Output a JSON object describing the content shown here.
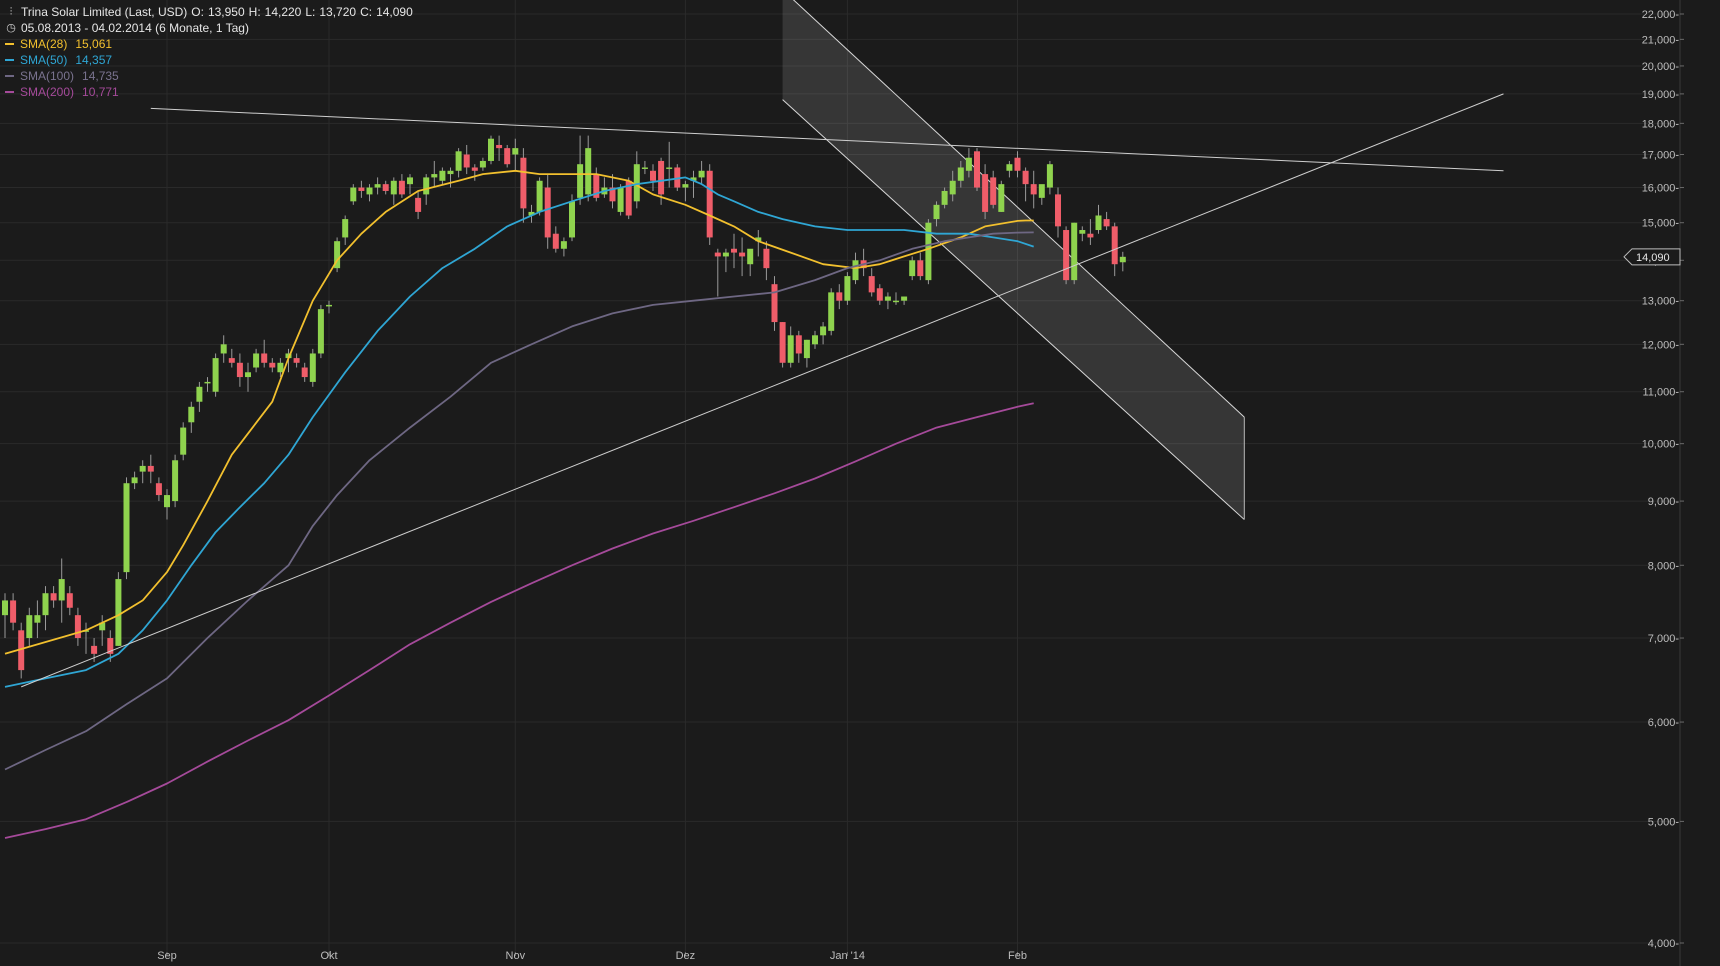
{
  "chart_data": {
    "type": "candlestick",
    "title": "Trina Solar Limited (Last, USD)",
    "quote": {
      "O": "13,950",
      "H": "14,220",
      "L": "13,720",
      "C": "14,090"
    },
    "period": "05.08.2013 - 04.02.2014 (6 Monate, 1 Tag)",
    "last_price_label": "14,090",
    "y_scale": "log",
    "ylim": [
      4000,
      22500
    ],
    "y_ticks": [
      {
        "value": 4000,
        "label": "4,000"
      },
      {
        "value": 5000,
        "label": "5,000"
      },
      {
        "value": 6000,
        "label": "6,000"
      },
      {
        "value": 7000,
        "label": "7,000"
      },
      {
        "value": 8000,
        "label": "8,000"
      },
      {
        "value": 9000,
        "label": "9,000"
      },
      {
        "value": 10000,
        "label": "10,000"
      },
      {
        "value": 11000,
        "label": "11,000"
      },
      {
        "value": 12000,
        "label": "12,000"
      },
      {
        "value": 13000,
        "label": "13,000"
      },
      {
        "value": 14000,
        "label": "14,000"
      },
      {
        "value": 15000,
        "label": "15,000"
      },
      {
        "value": 16000,
        "label": "16,000"
      },
      {
        "value": 17000,
        "label": "17,000"
      },
      {
        "value": 18000,
        "label": "18,000"
      },
      {
        "value": 19000,
        "label": "19,000"
      },
      {
        "value": 20000,
        "label": "20,000"
      },
      {
        "value": 21000,
        "label": "21,000"
      },
      {
        "value": 22000,
        "label": "22,000"
      }
    ],
    "x_ticks": [
      {
        "index": 20,
        "label": "Sep"
      },
      {
        "index": 40,
        "label": "Okt"
      },
      {
        "index": 63,
        "label": "Nov"
      },
      {
        "index": 84,
        "label": "Dez"
      },
      {
        "index": 104,
        "label": "Jan '14"
      },
      {
        "index": 125,
        "label": "Feb"
      }
    ],
    "grid": true,
    "colors": {
      "up": "#8fd34e",
      "down": "#ef5d69",
      "bg": "#1b1b1b",
      "grid": "#2a2a2a",
      "text": "#bdbdbd"
    },
    "candles": [
      [
        7.3,
        7.6,
        7.0,
        7.5
      ],
      [
        7.5,
        7.6,
        7.1,
        7.2
      ],
      [
        7.1,
        7.2,
        6.5,
        6.6
      ],
      [
        7.0,
        7.4,
        6.9,
        7.3
      ],
      [
        7.2,
        7.5,
        7.0,
        7.3
      ],
      [
        7.3,
        7.7,
        7.1,
        7.6
      ],
      [
        7.6,
        7.7,
        7.4,
        7.5
      ],
      [
        7.5,
        8.1,
        7.2,
        7.8
      ],
      [
        7.6,
        7.7,
        7.3,
        7.4
      ],
      [
        7.3,
        7.4,
        6.9,
        7.0
      ],
      [
        7.1,
        7.2,
        6.8,
        7.1
      ],
      [
        6.9,
        7.0,
        6.7,
        6.8
      ],
      [
        7.1,
        7.3,
        6.9,
        7.2
      ],
      [
        7.0,
        7.1,
        6.7,
        6.8
      ],
      [
        6.9,
        7.9,
        6.9,
        7.8
      ],
      [
        7.9,
        9.4,
        7.8,
        9.3
      ],
      [
        9.3,
        9.5,
        9.2,
        9.4
      ],
      [
        9.5,
        9.7,
        9.3,
        9.6
      ],
      [
        9.6,
        9.8,
        9.3,
        9.5
      ],
      [
        9.3,
        9.4,
        9.0,
        9.1
      ],
      [
        8.9,
        9.2,
        8.7,
        9.1
      ],
      [
        9.0,
        9.8,
        8.9,
        9.7
      ],
      [
        9.8,
        10.4,
        9.7,
        10.3
      ],
      [
        10.4,
        10.8,
        10.2,
        10.7
      ],
      [
        10.8,
        11.2,
        10.6,
        11.1
      ],
      [
        11.2,
        11.3,
        11.0,
        11.2
      ],
      [
        11.0,
        11.8,
        10.9,
        11.7
      ],
      [
        11.8,
        12.2,
        11.6,
        12.0
      ],
      [
        11.7,
        11.9,
        11.5,
        11.6
      ],
      [
        11.6,
        11.8,
        11.1,
        11.3
      ],
      [
        11.3,
        11.6,
        11.0,
        11.4
      ],
      [
        11.5,
        11.9,
        11.4,
        11.8
      ],
      [
        11.8,
        12.1,
        11.5,
        11.6
      ],
      [
        11.6,
        11.7,
        11.4,
        11.5
      ],
      [
        11.4,
        11.7,
        11.3,
        11.6
      ],
      [
        11.7,
        11.9,
        11.4,
        11.8
      ],
      [
        11.7,
        11.8,
        11.5,
        11.6
      ],
      [
        11.5,
        11.6,
        11.2,
        11.3
      ],
      [
        11.2,
        11.9,
        11.1,
        11.8
      ],
      [
        11.8,
        12.9,
        11.7,
        12.8
      ],
      [
        12.9,
        13.0,
        12.7,
        12.9
      ],
      [
        13.8,
        14.6,
        13.7,
        14.5
      ],
      [
        14.6,
        15.2,
        14.4,
        15.1
      ],
      [
        15.6,
        16.1,
        15.5,
        16.0
      ],
      [
        16.0,
        16.2,
        15.7,
        15.9
      ],
      [
        15.8,
        16.1,
        15.6,
        16.0
      ],
      [
        16.0,
        16.3,
        15.8,
        16.1
      ],
      [
        16.1,
        16.2,
        15.8,
        15.9
      ],
      [
        15.8,
        16.3,
        15.5,
        16.2
      ],
      [
        16.2,
        16.4,
        15.7,
        15.8
      ],
      [
        16.1,
        16.4,
        15.8,
        16.3
      ],
      [
        15.7,
        15.9,
        15.1,
        15.3
      ],
      [
        15.8,
        16.4,
        15.5,
        16.3
      ],
      [
        16.3,
        16.8,
        16.0,
        16.4
      ],
      [
        16.2,
        16.6,
        16.1,
        16.5
      ],
      [
        16.4,
        16.6,
        16.0,
        16.5
      ],
      [
        16.5,
        17.2,
        16.3,
        17.1
      ],
      [
        17.0,
        17.3,
        16.4,
        16.6
      ],
      [
        16.6,
        16.7,
        16.2,
        16.5
      ],
      [
        16.6,
        16.9,
        16.5,
        16.8
      ],
      [
        16.8,
        17.6,
        16.7,
        17.5
      ],
      [
        17.3,
        17.6,
        16.8,
        17.2
      ],
      [
        17.2,
        17.3,
        16.6,
        16.7
      ],
      [
        17.0,
        17.5,
        16.5,
        17.2
      ],
      [
        16.9,
        17.2,
        15.0,
        15.4
      ],
      [
        15.2,
        15.5,
        15.0,
        15.3
      ],
      [
        15.3,
        16.3,
        15.2,
        16.2
      ],
      [
        16.0,
        16.4,
        14.3,
        14.6
      ],
      [
        14.7,
        14.9,
        14.2,
        14.3
      ],
      [
        14.3,
        14.6,
        14.1,
        14.5
      ],
      [
        14.6,
        15.8,
        14.5,
        15.6
      ],
      [
        15.7,
        17.6,
        15.5,
        16.7
      ],
      [
        15.8,
        17.6,
        15.6,
        17.2
      ],
      [
        16.4,
        16.6,
        15.6,
        15.7
      ],
      [
        15.8,
        16.3,
        15.7,
        16.0
      ],
      [
        16.0,
        16.4,
        15.4,
        15.6
      ],
      [
        15.3,
        16.1,
        15.2,
        16.0
      ],
      [
        16.2,
        16.3,
        15.1,
        15.2
      ],
      [
        15.6,
        17.1,
        15.4,
        16.7
      ],
      [
        16.6,
        16.8,
        16.4,
        16.6
      ],
      [
        16.5,
        16.7,
        15.9,
        16.2
      ],
      [
        16.8,
        16.9,
        15.5,
        15.8
      ],
      [
        16.6,
        17.4,
        16.0,
        16.6
      ],
      [
        16.6,
        16.7,
        15.9,
        16.0
      ],
      [
        16.0,
        16.2,
        15.6,
        16.1
      ],
      [
        16.2,
        16.5,
        15.7,
        16.3
      ],
      [
        16.3,
        16.8,
        16.1,
        16.5
      ],
      [
        16.5,
        16.7,
        14.4,
        14.6
      ],
      [
        14.2,
        14.3,
        13.1,
        14.1
      ],
      [
        14.1,
        14.3,
        13.7,
        14.2
      ],
      [
        14.3,
        14.7,
        13.8,
        14.2
      ],
      [
        14.2,
        14.6,
        13.6,
        14.1
      ],
      [
        13.9,
        14.0,
        13.6,
        14.3
      ],
      [
        14.5,
        14.8,
        14.1,
        14.6
      ],
      [
        14.3,
        14.5,
        13.5,
        13.8
      ],
      [
        13.4,
        13.6,
        12.3,
        12.5
      ],
      [
        12.5,
        12.5,
        11.5,
        11.6
      ],
      [
        11.6,
        12.4,
        11.5,
        12.2
      ],
      [
        12.2,
        12.3,
        11.6,
        11.8
      ],
      [
        11.7,
        12.1,
        11.5,
        12.1
      ],
      [
        12.0,
        12.3,
        11.9,
        12.2
      ],
      [
        12.2,
        12.5,
        12.0,
        12.4
      ],
      [
        12.3,
        13.3,
        12.2,
        13.2
      ],
      [
        13.2,
        13.4,
        12.8,
        13.0
      ],
      [
        13.0,
        13.7,
        12.9,
        13.6
      ],
      [
        13.5,
        14.2,
        13.4,
        14.0
      ],
      [
        14.0,
        14.3,
        13.6,
        13.8
      ],
      [
        13.6,
        13.8,
        13.1,
        13.2
      ],
      [
        13.3,
        13.4,
        12.9,
        13.0
      ],
      [
        13.0,
        13.2,
        12.8,
        13.1
      ],
      [
        13.0,
        13.2,
        12.9,
        13.0
      ],
      [
        13.0,
        13.1,
        12.9,
        13.1
      ],
      [
        13.6,
        14.1,
        13.5,
        14.0
      ],
      [
        14.0,
        14.2,
        13.5,
        13.6
      ],
      [
        13.5,
        15.1,
        13.4,
        15.0
      ],
      [
        15.1,
        15.6,
        14.9,
        15.5
      ],
      [
        15.5,
        16.0,
        15.4,
        15.9
      ],
      [
        15.8,
        16.5,
        15.6,
        16.2
      ],
      [
        16.2,
        16.8,
        16.0,
        16.6
      ],
      [
        16.5,
        17.2,
        16.3,
        16.9
      ],
      [
        17.1,
        17.2,
        15.9,
        16.0
      ],
      [
        16.4,
        16.7,
        15.1,
        15.3
      ],
      [
        16.3,
        16.5,
        15.4,
        15.5
      ],
      [
        15.3,
        16.2,
        15.3,
        16.1
      ],
      [
        16.5,
        16.8,
        16.3,
        16.7
      ],
      [
        16.9,
        17.1,
        16.3,
        16.5
      ],
      [
        16.5,
        16.6,
        15.6,
        16.1
      ],
      [
        16.1,
        16.5,
        15.4,
        15.8
      ],
      [
        15.7,
        16.0,
        15.5,
        16.1
      ],
      [
        16.0,
        16.8,
        15.8,
        16.7
      ],
      [
        15.8,
        16.0,
        14.6,
        14.9
      ],
      [
        14.8,
        14.9,
        13.4,
        13.5
      ],
      [
        13.5,
        15.0,
        13.4,
        15.0
      ],
      [
        14.7,
        14.9,
        14.5,
        14.8
      ],
      [
        14.7,
        15.1,
        14.4,
        14.6
      ],
      [
        14.8,
        15.5,
        14.7,
        15.2
      ],
      [
        15.1,
        15.3,
        14.8,
        14.9
      ],
      [
        14.9,
        15.0,
        13.6,
        13.9
      ],
      [
        13.95,
        14.22,
        13.72,
        14.09
      ]
    ],
    "series": [
      {
        "name": "SMA(28)",
        "value_label": "15,061",
        "color": "#f2c02e",
        "x": [
          0,
          10,
          14,
          17,
          20,
          22,
          25,
          28,
          33,
          35,
          38,
          41,
          44,
          47,
          51,
          56,
          59,
          63,
          66,
          69,
          73,
          77,
          80,
          84,
          87,
          90,
          93,
          97,
          101,
          105,
          108,
          111,
          114,
          118,
          121,
          125,
          126,
          127
        ],
        "y": [
          6.8,
          7.1,
          7.3,
          7.5,
          7.9,
          8.3,
          9.0,
          9.8,
          10.8,
          11.7,
          13.0,
          14.0,
          14.7,
          15.3,
          15.9,
          16.2,
          16.4,
          16.5,
          16.4,
          16.4,
          16.4,
          16.2,
          15.8,
          15.5,
          15.2,
          14.9,
          14.5,
          14.2,
          13.9,
          13.8,
          13.9,
          14.1,
          14.3,
          14.6,
          14.9,
          15.05,
          15.06,
          15.061
        ]
      },
      {
        "name": "SMA(50)",
        "value_label": "14,357",
        "color": "#2fa6d4",
        "x": [
          0,
          5,
          10,
          14,
          17,
          20,
          23,
          26,
          29,
          32,
          35,
          38,
          42,
          46,
          50,
          54,
          58,
          62,
          66,
          70,
          74,
          78,
          81,
          84,
          86,
          88,
          90,
          93,
          96,
          100,
          104,
          107,
          111,
          115,
          119,
          122,
          125,
          127
        ],
        "y": [
          6.4,
          6.5,
          6.6,
          6.8,
          7.1,
          7.5,
          8.0,
          8.5,
          8.9,
          9.3,
          9.8,
          10.5,
          11.4,
          12.3,
          13.1,
          13.8,
          14.3,
          14.9,
          15.3,
          15.6,
          15.9,
          16.1,
          16.2,
          16.3,
          16.1,
          15.8,
          15.6,
          15.3,
          15.1,
          14.9,
          14.8,
          14.8,
          14.8,
          14.7,
          14.7,
          14.6,
          14.5,
          14.357
        ]
      },
      {
        "name": "SMA(100)",
        "value_label": "14,735",
        "color": "#6e6783",
        "x": [
          0,
          5,
          10,
          15,
          20,
          25,
          30,
          35,
          38,
          41,
          45,
          50,
          55,
          60,
          65,
          70,
          75,
          80,
          85,
          90,
          95,
          100,
          104,
          108,
          112,
          116,
          119,
          122,
          125,
          127
        ],
        "y": [
          5.5,
          5.7,
          5.9,
          6.2,
          6.5,
          7.0,
          7.5,
          8.0,
          8.6,
          9.1,
          9.7,
          10.3,
          10.9,
          11.6,
          12.0,
          12.4,
          12.7,
          12.9,
          13.0,
          13.1,
          13.2,
          13.5,
          13.8,
          14.0,
          14.3,
          14.5,
          14.6,
          14.7,
          14.73,
          14.735
        ]
      },
      {
        "name": "SMA(200)",
        "value_label": "10,771",
        "color": "#a54a9a",
        "x": [
          0,
          5,
          10,
          15,
          20,
          25,
          30,
          35,
          40,
          45,
          50,
          55,
          60,
          65,
          70,
          75,
          80,
          85,
          90,
          95,
          100,
          105,
          110,
          115,
          120,
          125,
          127
        ],
        "y": [
          4.85,
          4.93,
          5.02,
          5.18,
          5.36,
          5.58,
          5.8,
          6.02,
          6.3,
          6.6,
          6.92,
          7.2,
          7.48,
          7.74,
          8.0,
          8.25,
          8.48,
          8.68,
          8.9,
          9.13,
          9.38,
          9.68,
          10.0,
          10.3,
          10.5,
          10.7,
          10.771
        ]
      }
    ],
    "annotations": [
      {
        "type": "trendline",
        "from": [
          18,
          18.5
        ],
        "to": [
          185,
          16.5
        ]
      },
      {
        "type": "trendline",
        "from": [
          2,
          6.4
        ],
        "to": [
          185,
          19.0
        ]
      },
      {
        "type": "channel",
        "upper_from": [
          96,
          23.0
        ],
        "upper_to": [
          153,
          10.5
        ],
        "lower_from": [
          96,
          18.8
        ],
        "lower_to": [
          153,
          8.7
        ]
      }
    ]
  }
}
